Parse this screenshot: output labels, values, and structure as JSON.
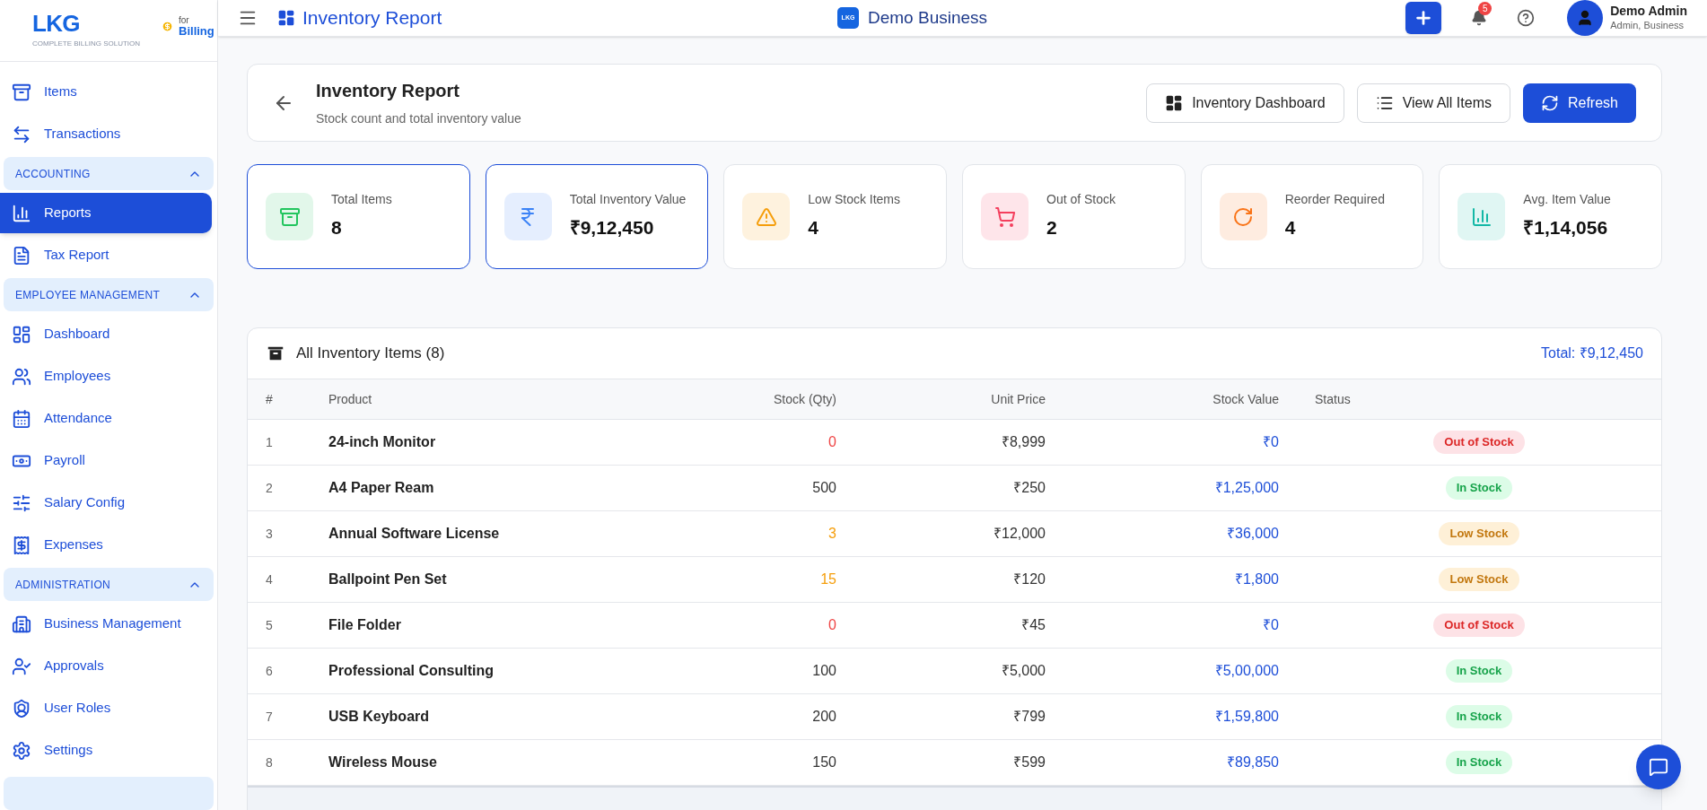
{
  "brand": {
    "logo": "LKG",
    "tagline": "COMPLETE BILLING SOLUTION",
    "for": "for",
    "product": "Billing"
  },
  "sidebar": {
    "items": [
      {
        "kind": "item",
        "label": "Items",
        "selected": false
      },
      {
        "kind": "item",
        "label": "Transactions",
        "selected": false
      },
      {
        "kind": "section",
        "label": "ACCOUNTING",
        "expanded": true
      },
      {
        "kind": "item",
        "label": "Reports",
        "selected": true
      },
      {
        "kind": "item",
        "label": "Tax Report",
        "selected": false
      },
      {
        "kind": "section",
        "label": "EMPLOYEE MANAGEMENT",
        "expanded": true
      },
      {
        "kind": "item",
        "label": "Dashboard",
        "selected": false
      },
      {
        "kind": "item",
        "label": "Employees",
        "selected": false
      },
      {
        "kind": "item",
        "label": "Attendance",
        "selected": false
      },
      {
        "kind": "item",
        "label": "Payroll",
        "selected": false
      },
      {
        "kind": "item",
        "label": "Salary Config",
        "selected": false
      },
      {
        "kind": "item",
        "label": "Expenses",
        "selected": false
      },
      {
        "kind": "section",
        "label": "ADMINISTRATION",
        "expanded": true
      },
      {
        "kind": "item",
        "label": "Business Management",
        "selected": false
      },
      {
        "kind": "item",
        "label": "Approvals",
        "selected": false
      },
      {
        "kind": "item",
        "label": "User Roles",
        "selected": false
      },
      {
        "kind": "item",
        "label": "Settings",
        "selected": false
      }
    ]
  },
  "topbar": {
    "title": "Inventory Report",
    "business": "Demo Business",
    "business_logo": "LKG",
    "notifications": "5",
    "user": {
      "name": "Demo Admin",
      "role": "Admin, Business"
    }
  },
  "page_header": {
    "title": "Inventory Report",
    "subtitle": "Stock count and total inventory value",
    "buttons": [
      {
        "label": "Inventory Dashboard",
        "kind": "outline"
      },
      {
        "label": "View All Items",
        "kind": "outline"
      },
      {
        "label": "Refresh",
        "kind": "primary"
      }
    ]
  },
  "stats": [
    {
      "label": "Total Items",
      "value": "8",
      "color": "#22c55e",
      "selected": true
    },
    {
      "label": "Total Inventory Value",
      "value": "₹9,12,450",
      "color": "#3b82f6",
      "selected": true
    },
    {
      "label": "Low Stock Items",
      "value": "4",
      "color": "#f59e0b",
      "selected": false
    },
    {
      "label": "Out of Stock",
      "value": "2",
      "color": "#f43f5e",
      "selected": false
    },
    {
      "label": "Reorder Required",
      "value": "4",
      "color": "#f97316",
      "selected": false
    },
    {
      "label": "Avg. Item Value",
      "value": "₹1,14,056",
      "color": "#14b8a6",
      "selected": false
    }
  ],
  "table": {
    "title": "All Inventory Items (8)",
    "total": "Total: ₹9,12,450",
    "columns": [
      "#",
      "Product",
      "Stock (Qty)",
      "Unit Price",
      "Stock Value",
      "Status"
    ],
    "rows": [
      {
        "n": "1",
        "product": "24-inch Monitor",
        "qty": "0",
        "price": "₹8,999",
        "value": "₹0",
        "status": "Out of Stock",
        "kind": "out"
      },
      {
        "n": "2",
        "product": "A4 Paper Ream",
        "qty": "500",
        "price": "₹250",
        "value": "₹1,25,000",
        "status": "In Stock",
        "kind": "in"
      },
      {
        "n": "3",
        "product": "Annual Software License",
        "qty": "3",
        "price": "₹12,000",
        "value": "₹36,000",
        "status": "Low Stock",
        "kind": "low"
      },
      {
        "n": "4",
        "product": "Ballpoint Pen Set",
        "qty": "15",
        "price": "₹120",
        "value": "₹1,800",
        "status": "Low Stock",
        "kind": "low"
      },
      {
        "n": "5",
        "product": "File Folder",
        "qty": "0",
        "price": "₹45",
        "value": "₹0",
        "status": "Out of Stock",
        "kind": "out"
      },
      {
        "n": "6",
        "product": "Professional Consulting",
        "qty": "100",
        "price": "₹5,000",
        "value": "₹5,00,000",
        "status": "In Stock",
        "kind": "in"
      },
      {
        "n": "7",
        "product": "USB Keyboard",
        "qty": "200",
        "price": "₹799",
        "value": "₹1,59,800",
        "status": "In Stock",
        "kind": "in"
      },
      {
        "n": "8",
        "product": "Wireless Mouse",
        "qty": "150",
        "price": "₹599",
        "value": "₹89,850",
        "status": "In Stock",
        "kind": "in"
      }
    ]
  }
}
